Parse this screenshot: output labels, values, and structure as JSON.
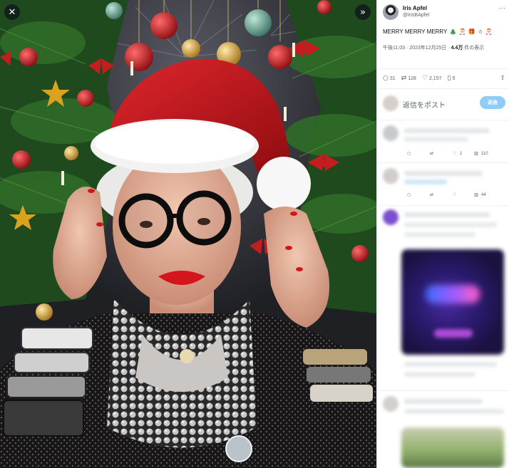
{
  "viewer": {
    "close_glyph": "✕",
    "expand_glyph": "»",
    "photo_alt": "Iris Apfel in a Santa hat in front of a Christmas tree"
  },
  "tweet": {
    "author_name": "Iris Apfel",
    "author_handle": "@IrisBApfel",
    "more_glyph": "···",
    "text": "MERRY MERRY MERRY",
    "emojis": [
      "🎄",
      "🎅",
      "🎁",
      "☃",
      "🎅"
    ],
    "time": "午後11:03 · 2023年12月25日 · ",
    "views_count": "4.4万",
    "views_suffix": " 件の表示"
  },
  "actions": {
    "replies": "31",
    "retweets": "128",
    "likes": "2,157",
    "bookmarks": "5"
  },
  "reply": {
    "placeholder": "返信をポスト",
    "button": "返信"
  },
  "replies_list": [
    {
      "likes": "1",
      "views": "110"
    },
    {
      "likes": "",
      "views": "44"
    }
  ],
  "colors": {
    "accent": "#1d9bf0",
    "reply_button": "#8ecdf7",
    "hat_red": "#c4161c"
  }
}
